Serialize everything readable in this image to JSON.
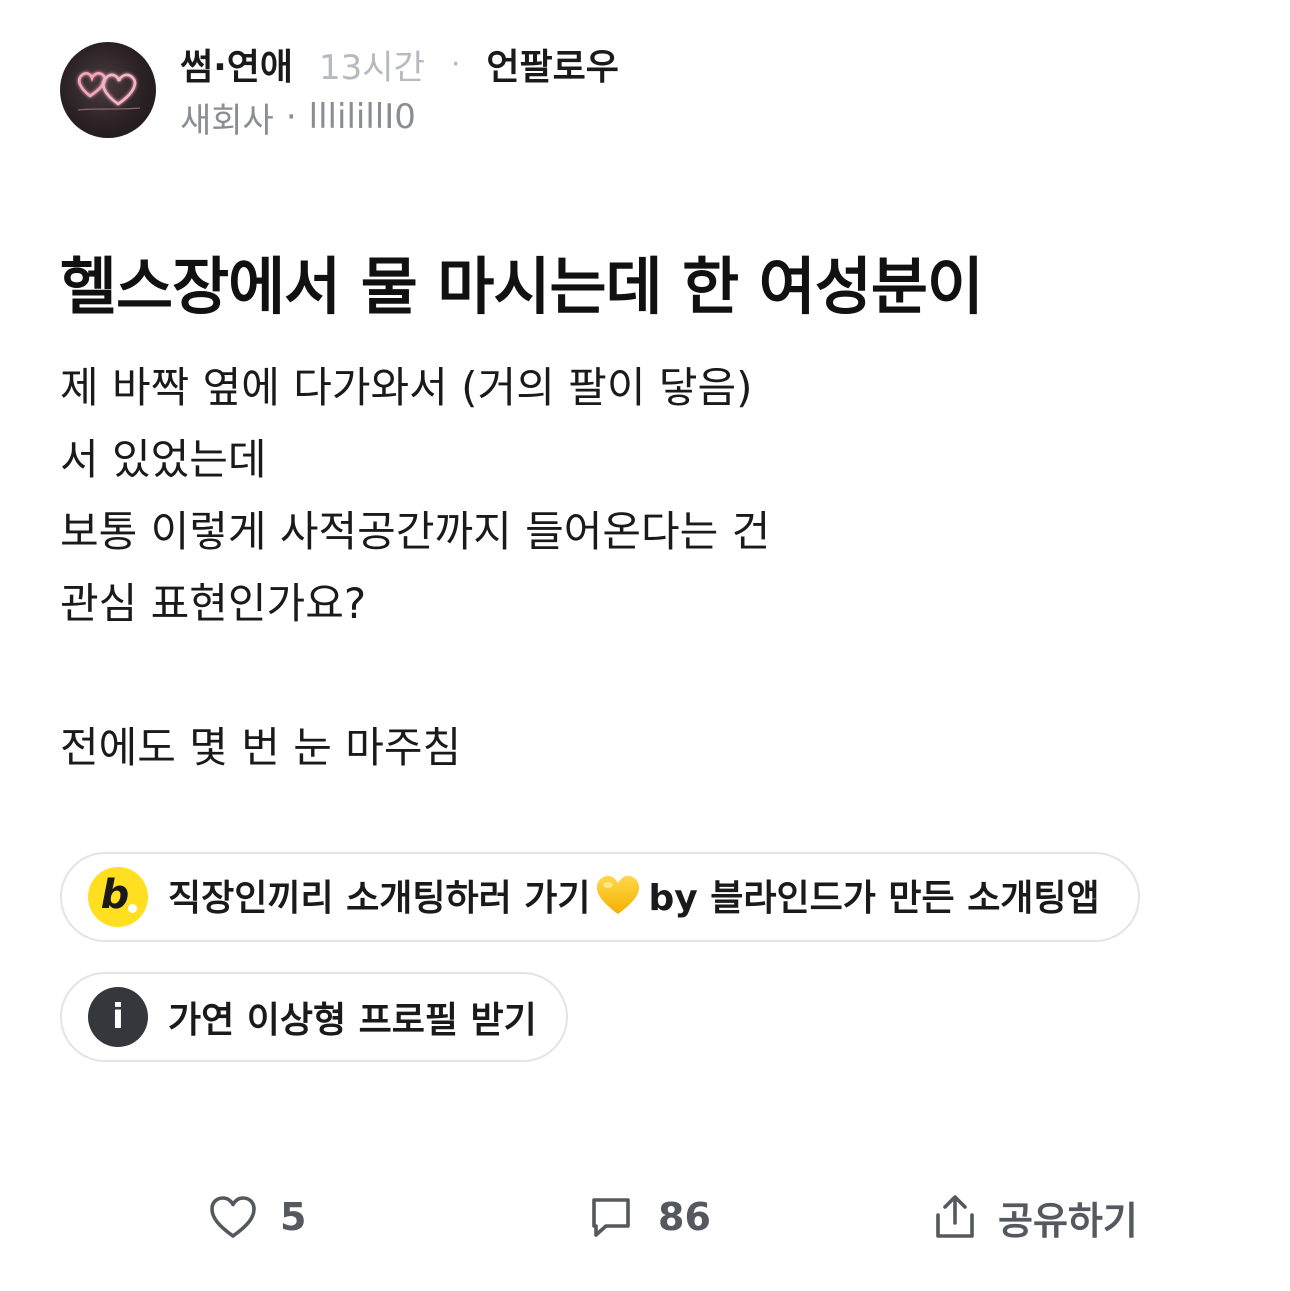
{
  "post_header": {
    "category": "썸·연애",
    "time": "13시간",
    "separator_dot": "·",
    "unfollow_label": "언팔로우",
    "company": "새회사",
    "author_separator": "·",
    "nickname": "lllilillI0",
    "avatar_icon": "neon-hearts-icon"
  },
  "post": {
    "title": "헬스장에서 물 마시는데 한 여성분이",
    "body_lines": [
      "제 바짝 옆에 다가와서 (거의 팔이 닿음)",
      "서 있었는데",
      "보통 이렇게 사적공간까지 들어온다는 건",
      "관심 표현인가요?",
      "",
      "전에도 몇 번 눈 마주침"
    ]
  },
  "links": [
    {
      "badge_letter": "b",
      "badge_color": "#ffdf1f",
      "label_prefix": "직장인끼리 소개팅하러 가기",
      "emoji": "yellow-heart-icon",
      "label_suffix": "by 블라인드가 만든 소개팅앱"
    },
    {
      "badge_letter": "i",
      "badge_color": "#35373d",
      "label": "가연 이상형 프로필 받기"
    }
  ],
  "actions": {
    "like_count": "5",
    "comment_count": "86",
    "share_label": "공유하기"
  }
}
